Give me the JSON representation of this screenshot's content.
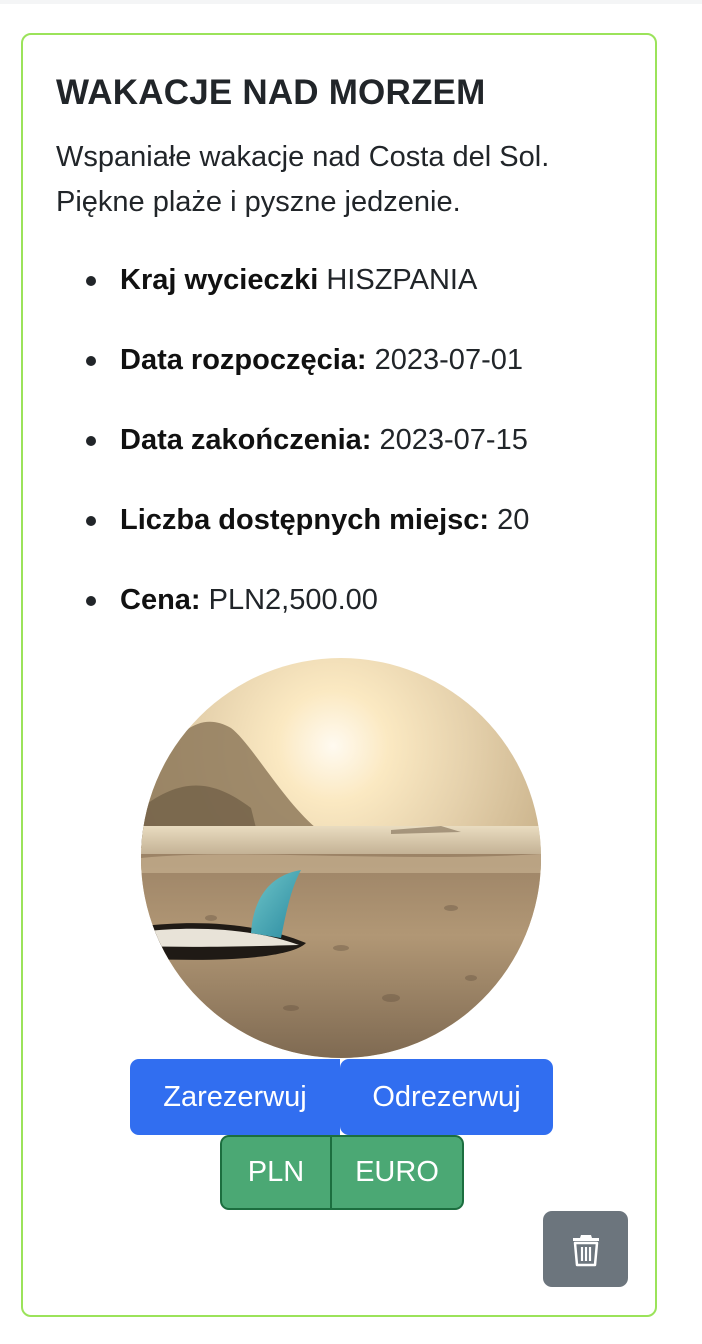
{
  "card": {
    "title": "WAKACJE NAD MORZEM",
    "description": "Wspaniałe wakacje nad Costa del Sol. Piękne plaże i pyszne jedzenie.",
    "details": [
      {
        "label": "Kraj wycieczki",
        "value": "HISZPANIA"
      },
      {
        "label": "Data rozpoczęcia:",
        "value": "2023-07-01"
      },
      {
        "label": "Data zakończenia:",
        "value": "2023-07-15"
      },
      {
        "label": "Liczba dostępnych miejsc:",
        "value": "20"
      },
      {
        "label": "Cena:",
        "value": "PLN2,500.00"
      }
    ],
    "border_color": "#9be35a"
  },
  "actions": {
    "reserve_label": "Zarezerwuj",
    "unreserve_label": "Odrezerwuj",
    "currency_pln_label": "PLN",
    "currency_euro_label": "EURO",
    "delete_icon": "trash-icon"
  },
  "colors": {
    "primary": "#316ef0",
    "success": "#4ba874",
    "secondary": "#6c757d"
  }
}
